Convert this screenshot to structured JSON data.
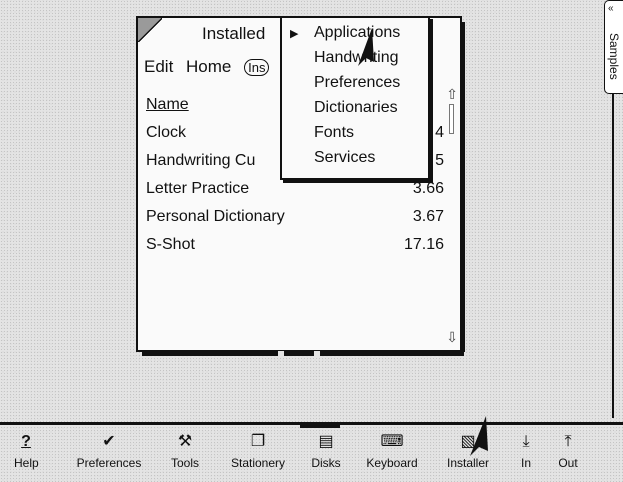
{
  "side_tab": {
    "label": "Samples",
    "arrow": "«"
  },
  "window": {
    "title": "Installed",
    "menu": {
      "edit": "Edit",
      "home": "Home",
      "pill": "Ins"
    },
    "columns": {
      "name": "Name",
      "size": ""
    },
    "rows": [
      {
        "name": "Clock",
        "size": "4"
      },
      {
        "name": "Handwriting Cu",
        "size": "5"
      },
      {
        "name": "Letter Practice",
        "size": "3.66"
      },
      {
        "name": "Personal Dictionary",
        "size": "3.67"
      },
      {
        "name": "S-Shot",
        "size": "17.16"
      }
    ],
    "scroll_up": "⇧",
    "scroll_down": "⇩"
  },
  "popup_menu": {
    "selected_marker": "▶",
    "items": [
      "Applications",
      "Handwriting",
      "Preferences",
      "Dictionaries",
      "Fonts",
      "Services"
    ]
  },
  "toolbar": {
    "items": [
      {
        "label": "Help",
        "icon": "?"
      },
      {
        "label": "Preferences",
        "icon": "✔"
      },
      {
        "label": "Tools",
        "icon": "⚒"
      },
      {
        "label": "Stationery",
        "icon": "❐"
      },
      {
        "label": "Disks",
        "icon": "▤"
      },
      {
        "label": "Keyboard",
        "icon": "⌨"
      },
      {
        "label": "Installer",
        "icon": "▧"
      },
      {
        "label": "In",
        "icon": "⤓"
      },
      {
        "label": "Out",
        "icon": "⤒"
      }
    ]
  }
}
